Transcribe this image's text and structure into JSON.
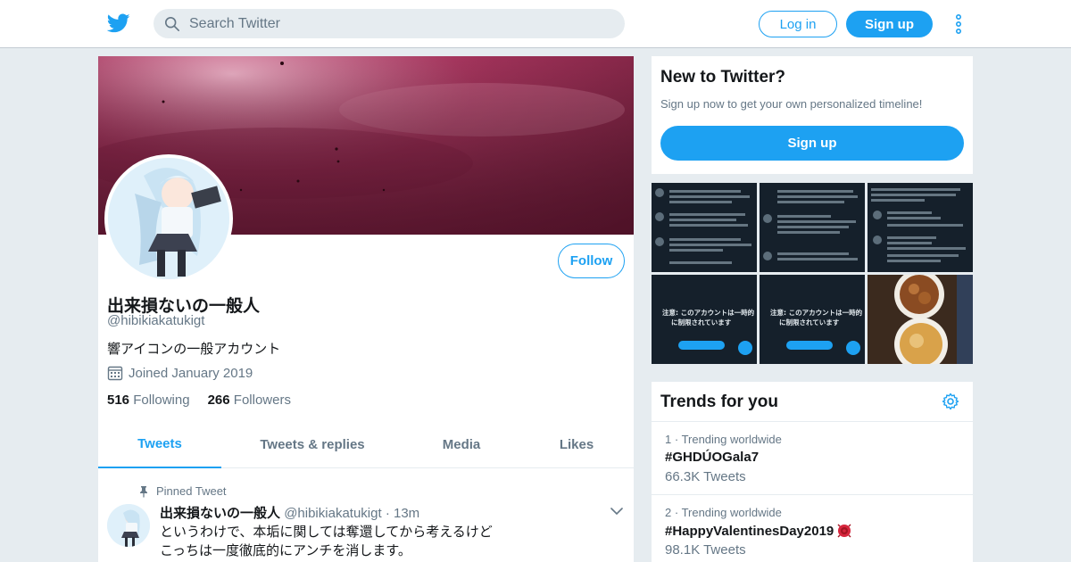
{
  "header": {
    "search_placeholder": "Search Twitter",
    "login_label": "Log in",
    "signup_label": "Sign up",
    "icons": {
      "logo": "twitter-bird-icon",
      "search": "search-icon",
      "more": "more-vertical-icon"
    }
  },
  "profile": {
    "follow_label": "Follow",
    "name": "出来損ないの一般人",
    "handle": "@hibikiakatukigt",
    "bio": "響アイコンの一般アカウント",
    "joined": "Joined January 2019",
    "following_count": "516",
    "following_label": "Following",
    "followers_count": "266",
    "followers_label": "Followers",
    "tabs": [
      {
        "label": "Tweets",
        "active": true
      },
      {
        "label": "Tweets & replies",
        "active": false
      },
      {
        "label": "Media",
        "active": false
      },
      {
        "label": "Likes",
        "active": false
      }
    ]
  },
  "pinned_tweet": {
    "pinned_label": "Pinned Tweet",
    "author_name": "出来損ないの一般人",
    "author_handle": "@hibikiakatukigt",
    "separator": "·",
    "time": "13m",
    "lines": [
      "というわけで、本垢に関しては奪還してから考えるけど",
      "こっちは一度徹底的にアンチを消します。"
    ]
  },
  "sidebar": {
    "new_to_twitter": {
      "title": "New to Twitter?",
      "subtitle": "Sign up now to get your own personalized timeline!",
      "signup_label": "Sign up"
    },
    "media_thumbs": [
      {
        "kind": "screenshot-dark",
        "caption": ""
      },
      {
        "kind": "screenshot-dark",
        "caption": ""
      },
      {
        "kind": "screenshot-dark",
        "caption": ""
      },
      {
        "kind": "locked-notice",
        "caption": "注意: このアカウントは一時的に制限されています"
      },
      {
        "kind": "locked-notice",
        "caption": "注意: このアカウントは一時的に制限されています"
      },
      {
        "kind": "food-photo",
        "caption": ""
      }
    ],
    "trends": {
      "title": "Trends for you",
      "items": [
        {
          "rank": "1",
          "meta": "Trending worldwide",
          "name": "#GHDÚOGala7",
          "count": "66.3K Tweets",
          "emoji": ""
        },
        {
          "rank": "2",
          "meta": "Trending worldwide",
          "name": "#HappyValentinesDay2019",
          "count": "98.1K Tweets",
          "emoji": "rose"
        }
      ]
    }
  },
  "colors": {
    "accent": "#1da1f2",
    "muted": "#657786",
    "background": "#e6ecf0",
    "banner": "#a4345c"
  }
}
